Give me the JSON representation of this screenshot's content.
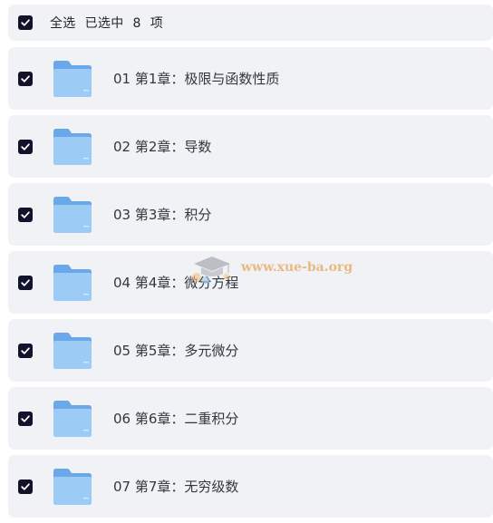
{
  "select_all": {
    "label": "全选",
    "selected_prefix": "已选中",
    "selected_count": "8",
    "selected_suffix": "项",
    "checked": true
  },
  "files": [
    {
      "name": "01 第1章：极限与函数性质",
      "icon": "folder-icon",
      "checked": true
    },
    {
      "name": "02 第2章：导数",
      "icon": "folder-icon",
      "checked": true
    },
    {
      "name": "03 第3章：积分",
      "icon": "folder-icon",
      "checked": true
    },
    {
      "name": "04 第4章：微分方程",
      "icon": "folder-icon",
      "checked": true
    },
    {
      "name": "05 第5章：多元微分",
      "icon": "folder-icon",
      "checked": true
    },
    {
      "name": "06 第6章：二重积分",
      "icon": "folder-icon",
      "checked": true
    },
    {
      "name": "07 第7章：无穷级数",
      "icon": "folder-icon",
      "checked": true
    }
  ],
  "watermark": {
    "text": "www.xue-ba.org"
  },
  "colors": {
    "checkbox": "#10132a",
    "row_background": "#f1f2f5",
    "folder_back": "#6aa8ea",
    "folder_front": "#9ccbf6",
    "watermark": "#e8b16b"
  }
}
